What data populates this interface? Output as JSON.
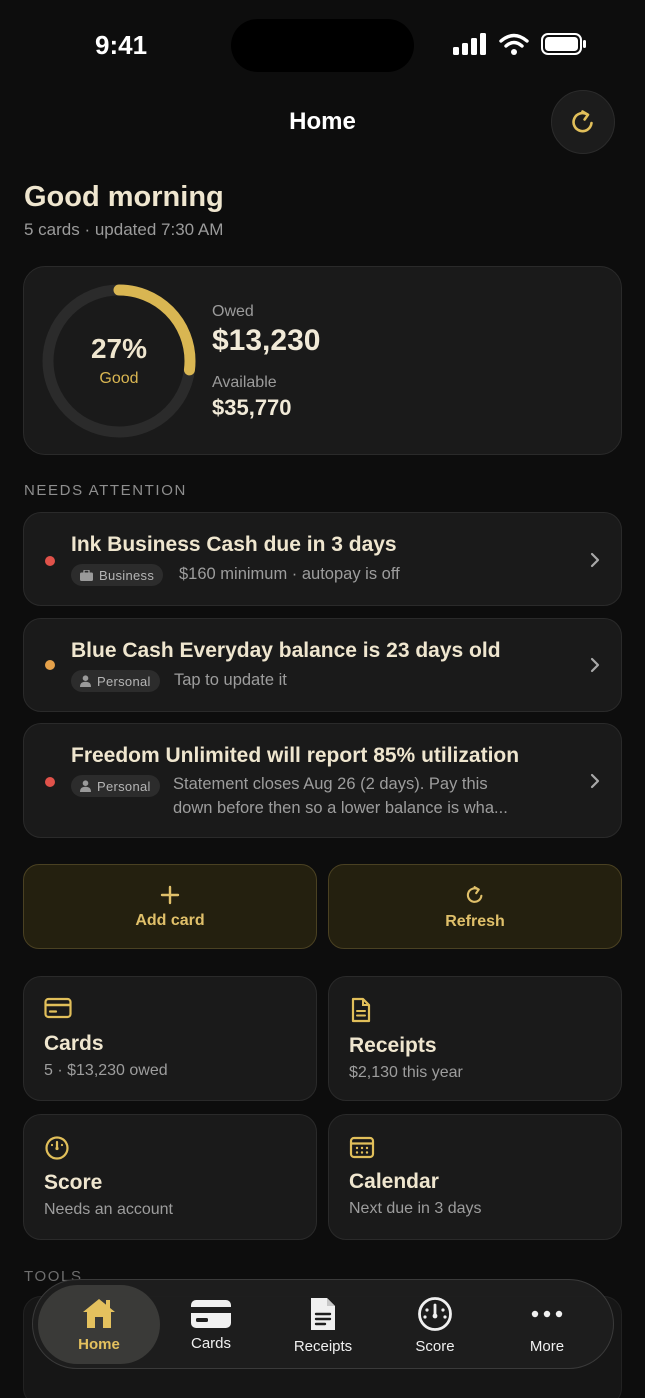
{
  "status": {
    "time": "9:41"
  },
  "header": {
    "title": "Home"
  },
  "greeting": {
    "title": "Good morning",
    "subtitle": "5 cards · updated 7:30 AM"
  },
  "summary": {
    "utilization_pct": 27,
    "utilization_text": "27%",
    "rating": "Good",
    "owed_label": "Owed",
    "owed_value": "$13,230",
    "available_label": "Available",
    "available_value": "$35,770"
  },
  "attention": {
    "heading": "NEEDS ATTENTION",
    "items": [
      {
        "title": "Ink Business Cash due in 3 days",
        "tag": "Business",
        "desc": "$160 minimum · autopay is off",
        "severity_color": "#e0524a"
      },
      {
        "title": "Blue Cash Everyday balance is 23 days old",
        "tag": "Personal",
        "desc": "Tap to update it",
        "severity_color": "#e5a14a"
      },
      {
        "title": "Freedom Unlimited will report 85% utilization",
        "tag": "Personal",
        "desc_line1": "Statement closes Aug 26 (2 days). Pay this",
        "desc_line2": "down before then so a lower balance is wha...",
        "severity_color": "#e0524a"
      }
    ]
  },
  "actions": {
    "add_card": "Add card",
    "refresh": "Refresh"
  },
  "tiles": {
    "cards": {
      "title": "Cards",
      "sub": "5 · $13,230 owed"
    },
    "receipts": {
      "title": "Receipts",
      "sub": "$2,130 this year"
    },
    "score": {
      "title": "Score",
      "sub": "Needs an account"
    },
    "calendar": {
      "title": "Calendar",
      "sub": "Next due in 3 days"
    }
  },
  "tools": {
    "heading": "TOOLS"
  },
  "tabbar": {
    "home": "Home",
    "cards": "Cards",
    "receipts": "Receipts",
    "score": "Score",
    "more": "More"
  },
  "colors": {
    "accent": "#d9b652",
    "background": "#0d0d0d",
    "card": "#1a1a1a"
  }
}
